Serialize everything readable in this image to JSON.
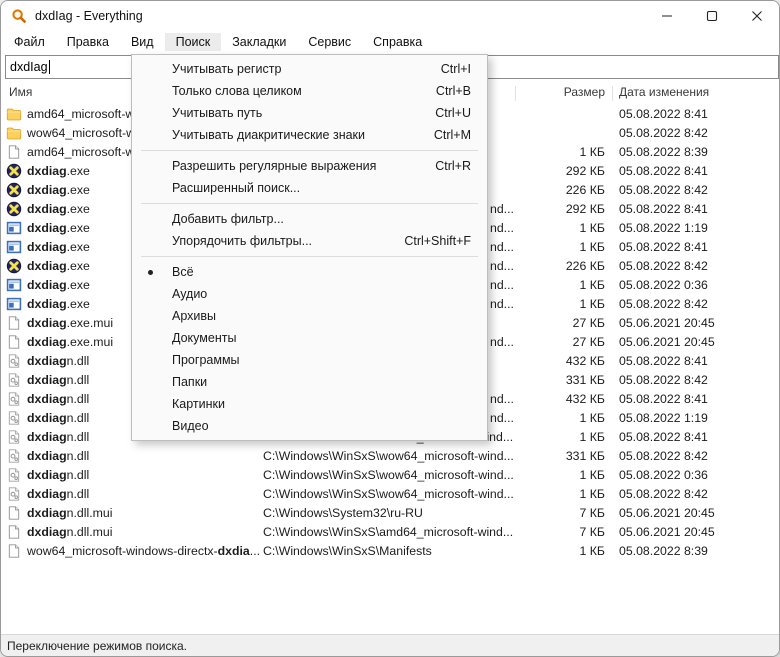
{
  "window": {
    "title": "dxdIag - Everything"
  },
  "titlebar_icons": [
    "everything-search-icon",
    "minimize-icon",
    "maximize-icon",
    "close-icon"
  ],
  "menubar": {
    "items": [
      "Файл",
      "Правка",
      "Вид",
      "Поиск",
      "Закладки",
      "Сервис",
      "Справка"
    ],
    "open_index": 3
  },
  "search": {
    "value": "dxdIag"
  },
  "columns": {
    "name": "Имя",
    "size": "Размер",
    "modified": "Дата изменения"
  },
  "menu": {
    "items": [
      {
        "label": "Учитывать регистр",
        "shortcut": "Ctrl+I"
      },
      {
        "label": "Только слова целиком",
        "shortcut": "Ctrl+B"
      },
      {
        "label": "Учитывать путь",
        "shortcut": "Ctrl+U"
      },
      {
        "label": "Учитывать диакритические знаки",
        "shortcut": "Ctrl+M",
        "sep": true
      },
      {
        "label": "Разрешить регулярные выражения",
        "shortcut": "Ctrl+R"
      },
      {
        "label": "Расширенный поиск...",
        "sep": true
      },
      {
        "label": "Добавить фильтр..."
      },
      {
        "label": "Упорядочить фильтры...",
        "shortcut": "Ctrl+Shift+F",
        "sep": true
      },
      {
        "label": "Всё",
        "selected": true
      },
      {
        "label": "Аудио"
      },
      {
        "label": "Архивы"
      },
      {
        "label": "Документы"
      },
      {
        "label": "Программы"
      },
      {
        "label": "Папки"
      },
      {
        "label": "Картинки"
      },
      {
        "label": "Видео"
      }
    ]
  },
  "rows": [
    {
      "icon": "folder-icon",
      "pre": "amd64_microsoft-wi",
      "bold": "",
      "post": "",
      "path": "",
      "frag": "",
      "size": "",
      "date": "05.08.2022 8:41"
    },
    {
      "icon": "folder-icon",
      "pre": "wow64_microsoft-wi",
      "bold": "",
      "post": "",
      "path": "",
      "frag": "",
      "size": "",
      "date": "05.08.2022 8:42"
    },
    {
      "icon": "file-icon",
      "pre": "amd64_microsoft-wi",
      "bold": "",
      "post": "",
      "path": "",
      "frag": "",
      "size": "1 КБ",
      "date": "05.08.2022 8:39"
    },
    {
      "icon": "directx-icon",
      "pre": "",
      "bold": "dxdiag",
      "post": ".exe",
      "path": "",
      "frag": "",
      "size": "292 КБ",
      "date": "05.08.2022 8:41"
    },
    {
      "icon": "directx-icon",
      "pre": "",
      "bold": "dxdiag",
      "post": ".exe",
      "path": "",
      "frag": "",
      "size": "226 КБ",
      "date": "05.08.2022 8:42"
    },
    {
      "icon": "directx-icon",
      "pre": "",
      "bold": "dxdiag",
      "post": ".exe",
      "path": "",
      "frag": "nd...",
      "size": "292 КБ",
      "date": "05.08.2022 8:41"
    },
    {
      "icon": "app-icon",
      "pre": "",
      "bold": "dxdiag",
      "post": ".exe",
      "path": "",
      "frag": "nd...",
      "size": "1 КБ",
      "date": "05.08.2022 1:19"
    },
    {
      "icon": "app-icon",
      "pre": "",
      "bold": "dxdiag",
      "post": ".exe",
      "path": "",
      "frag": "nd...",
      "size": "1 КБ",
      "date": "05.08.2022 8:41"
    },
    {
      "icon": "directx-icon",
      "pre": "",
      "bold": "dxdiag",
      "post": ".exe",
      "path": "",
      "frag": "nd...",
      "size": "226 КБ",
      "date": "05.08.2022 8:42"
    },
    {
      "icon": "app-icon",
      "pre": "",
      "bold": "dxdiag",
      "post": ".exe",
      "path": "",
      "frag": "nd...",
      "size": "1 КБ",
      "date": "05.08.2022 0:36"
    },
    {
      "icon": "app-icon",
      "pre": "",
      "bold": "dxdiag",
      "post": ".exe",
      "path": "",
      "frag": "nd...",
      "size": "1 КБ",
      "date": "05.08.2022 8:42"
    },
    {
      "icon": "file-icon",
      "pre": "",
      "bold": "dxdiag",
      "post": ".exe.mui",
      "path": "",
      "frag": "",
      "size": "27 КБ",
      "date": "05.06.2021 20:45"
    },
    {
      "icon": "file-icon",
      "pre": "",
      "bold": "dxdiag",
      "post": ".exe.mui",
      "path": "",
      "frag": "nd...",
      "size": "27 КБ",
      "date": "05.06.2021 20:45"
    },
    {
      "icon": "dll-icon",
      "pre": "",
      "bold": "dxdiag",
      "post": "n.dll",
      "path": "",
      "frag": "",
      "size": "432 КБ",
      "date": "05.08.2022 8:41"
    },
    {
      "icon": "dll-icon",
      "pre": "",
      "bold": "dxdiag",
      "post": "n.dll",
      "path": "",
      "frag": "",
      "size": "331 КБ",
      "date": "05.08.2022 8:42"
    },
    {
      "icon": "dll-icon",
      "pre": "",
      "bold": "dxdiag",
      "post": "n.dll",
      "path": "",
      "frag": "nd...",
      "size": "432 КБ",
      "date": "05.08.2022 8:41"
    },
    {
      "icon": "dll-icon",
      "pre": "",
      "bold": "dxdiag",
      "post": "n.dll",
      "path": "",
      "frag": "nd...",
      "size": "1 КБ",
      "date": "05.08.2022 1:19"
    },
    {
      "icon": "dll-icon",
      "pre": "",
      "bold": "dxdiag",
      "post": "n.dll",
      "path": "C:\\Windows\\WinSxS\\amd64_microsoft-wind...",
      "frag": "",
      "size": "1 КБ",
      "date": "05.08.2022 8:41"
    },
    {
      "icon": "dll-icon",
      "pre": "",
      "bold": "dxdiag",
      "post": "n.dll",
      "path": "C:\\Windows\\WinSxS\\wow64_microsoft-wind...",
      "frag": "",
      "size": "331 КБ",
      "date": "05.08.2022 8:42"
    },
    {
      "icon": "dll-icon",
      "pre": "",
      "bold": "dxdiag",
      "post": "n.dll",
      "path": "C:\\Windows\\WinSxS\\wow64_microsoft-wind...",
      "frag": "",
      "size": "1 КБ",
      "date": "05.08.2022 0:36"
    },
    {
      "icon": "dll-icon",
      "pre": "",
      "bold": "dxdiag",
      "post": "n.dll",
      "path": "C:\\Windows\\WinSxS\\wow64_microsoft-wind...",
      "frag": "",
      "size": "1 КБ",
      "date": "05.08.2022 8:42"
    },
    {
      "icon": "file-icon",
      "pre": "",
      "bold": "dxdiag",
      "post": "n.dll.mui",
      "path": "C:\\Windows\\System32\\ru-RU",
      "frag": "",
      "size": "7 КБ",
      "date": "05.06.2021 20:45"
    },
    {
      "icon": "file-icon",
      "pre": "",
      "bold": "dxdiag",
      "post": "n.dll.mui",
      "path": "C:\\Windows\\WinSxS\\amd64_microsoft-wind...",
      "frag": "",
      "size": "7 КБ",
      "date": "05.06.2021 20:45"
    },
    {
      "icon": "file-icon",
      "pre": "wow64_microsoft-windows-directx-",
      "bold": "dxdia",
      "post": "...",
      "path": "C:\\Windows\\WinSxS\\Manifests",
      "frag": "",
      "size": "1 КБ",
      "date": "05.08.2022 8:39"
    }
  ],
  "statusbar": {
    "text": "Переключение режимов поиска."
  }
}
